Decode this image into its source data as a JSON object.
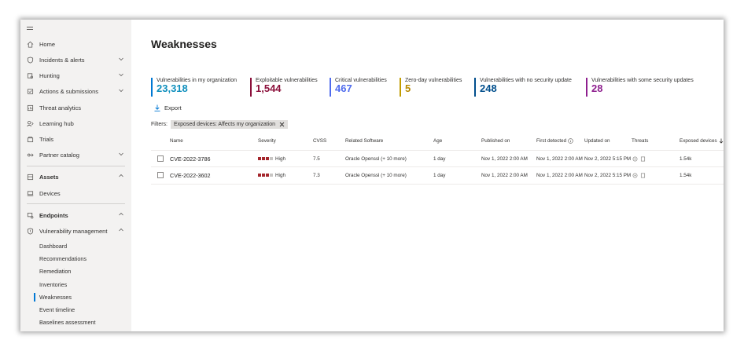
{
  "sidebar": {
    "items": [
      {
        "label": "Home",
        "icon": "home-icon"
      },
      {
        "label": "Incidents & alerts",
        "icon": "shield-icon",
        "chevron": "down"
      },
      {
        "label": "Hunting",
        "icon": "hunting-icon",
        "chevron": "down"
      },
      {
        "label": "Actions & submissions",
        "icon": "actions-icon",
        "chevron": "down"
      },
      {
        "label": "Threat analytics",
        "icon": "threat-analytics-icon"
      },
      {
        "label": "Learning hub",
        "icon": "learning-hub-icon"
      },
      {
        "label": "Trials",
        "icon": "trials-icon"
      },
      {
        "label": "Partner catalog",
        "icon": "partner-catalog-icon",
        "chevron": "down"
      }
    ],
    "assets": {
      "label": "Assets",
      "icon": "assets-icon",
      "chevron": "up"
    },
    "devices": {
      "label": "Devices",
      "icon": "devices-icon"
    },
    "endpoints": {
      "label": "Endpoints",
      "icon": "endpoints-icon",
      "chevron": "up"
    },
    "vuln_mgmt": {
      "label": "Vulnerability management",
      "icon": "vulnerability-icon",
      "chevron": "up"
    },
    "sub_items": [
      {
        "label": "Dashboard"
      },
      {
        "label": "Recommendations"
      },
      {
        "label": "Remediation"
      },
      {
        "label": "Inventories"
      },
      {
        "label": "Weaknesses",
        "active": true
      },
      {
        "label": "Event timeline"
      },
      {
        "label": "Baselines assessment"
      }
    ]
  },
  "page": {
    "title": "Weaknesses"
  },
  "stats": [
    {
      "label": "Vulnerabilities in my organization",
      "value": "23,318",
      "color": "#0078d4",
      "valcolor": "#0f8fbd"
    },
    {
      "label": "Exploitable vulnerabilities",
      "value": "1,544",
      "color": "#8b0f3a",
      "valcolor": "#8b0f3a"
    },
    {
      "label": "Critical vulnerabilities",
      "value": "467",
      "color": "#4f6bed",
      "valcolor": "#4f6bed"
    },
    {
      "label": "Zero-day vulnerabilities",
      "value": "5",
      "color": "#c19c00",
      "valcolor": "#b88a00"
    },
    {
      "label": "Vulnerabilities with no security update",
      "value": "248",
      "color": "#004e8c",
      "valcolor": "#004e8c"
    },
    {
      "label": "Vulnerabilities with some security updates",
      "value": "28",
      "color": "#8e1f8e",
      "valcolor": "#8e1f8e"
    }
  ],
  "toolbar": {
    "export_label": "Export"
  },
  "filters": {
    "label": "Filters:",
    "chip": "Exposed devices: Affects my organization"
  },
  "table": {
    "headers": {
      "name": "Name",
      "severity": "Severity",
      "cvss": "CVSS",
      "software": "Related Software",
      "age": "Age",
      "published": "Published on",
      "first_detected": "First detected",
      "updated": "Updated on",
      "threats": "Threats",
      "exposed": "Exposed devices"
    },
    "rows": [
      {
        "name": "CVE-2022-3786",
        "severity": "High",
        "cvss": "7.5",
        "software": "Oracle Openssl (+ 10 more)",
        "age": "1 day",
        "published": "Nov 1, 2022 2:00 AM",
        "first_detected": "Nov 1, 2022 2:00 AM",
        "updated": "Nov 2, 2022 5:15 PM",
        "exposed": "1.54k"
      },
      {
        "name": "CVE-2022-3602",
        "severity": "High",
        "cvss": "7.3",
        "software": "Oracle Openssl (+ 10 more)",
        "age": "1 day",
        "published": "Nov 1, 2022 2:00 AM",
        "first_detected": "Nov 1, 2022 2:00 AM",
        "updated": "Nov 2, 2022 5:15 PM",
        "exposed": "1.54k"
      }
    ]
  }
}
